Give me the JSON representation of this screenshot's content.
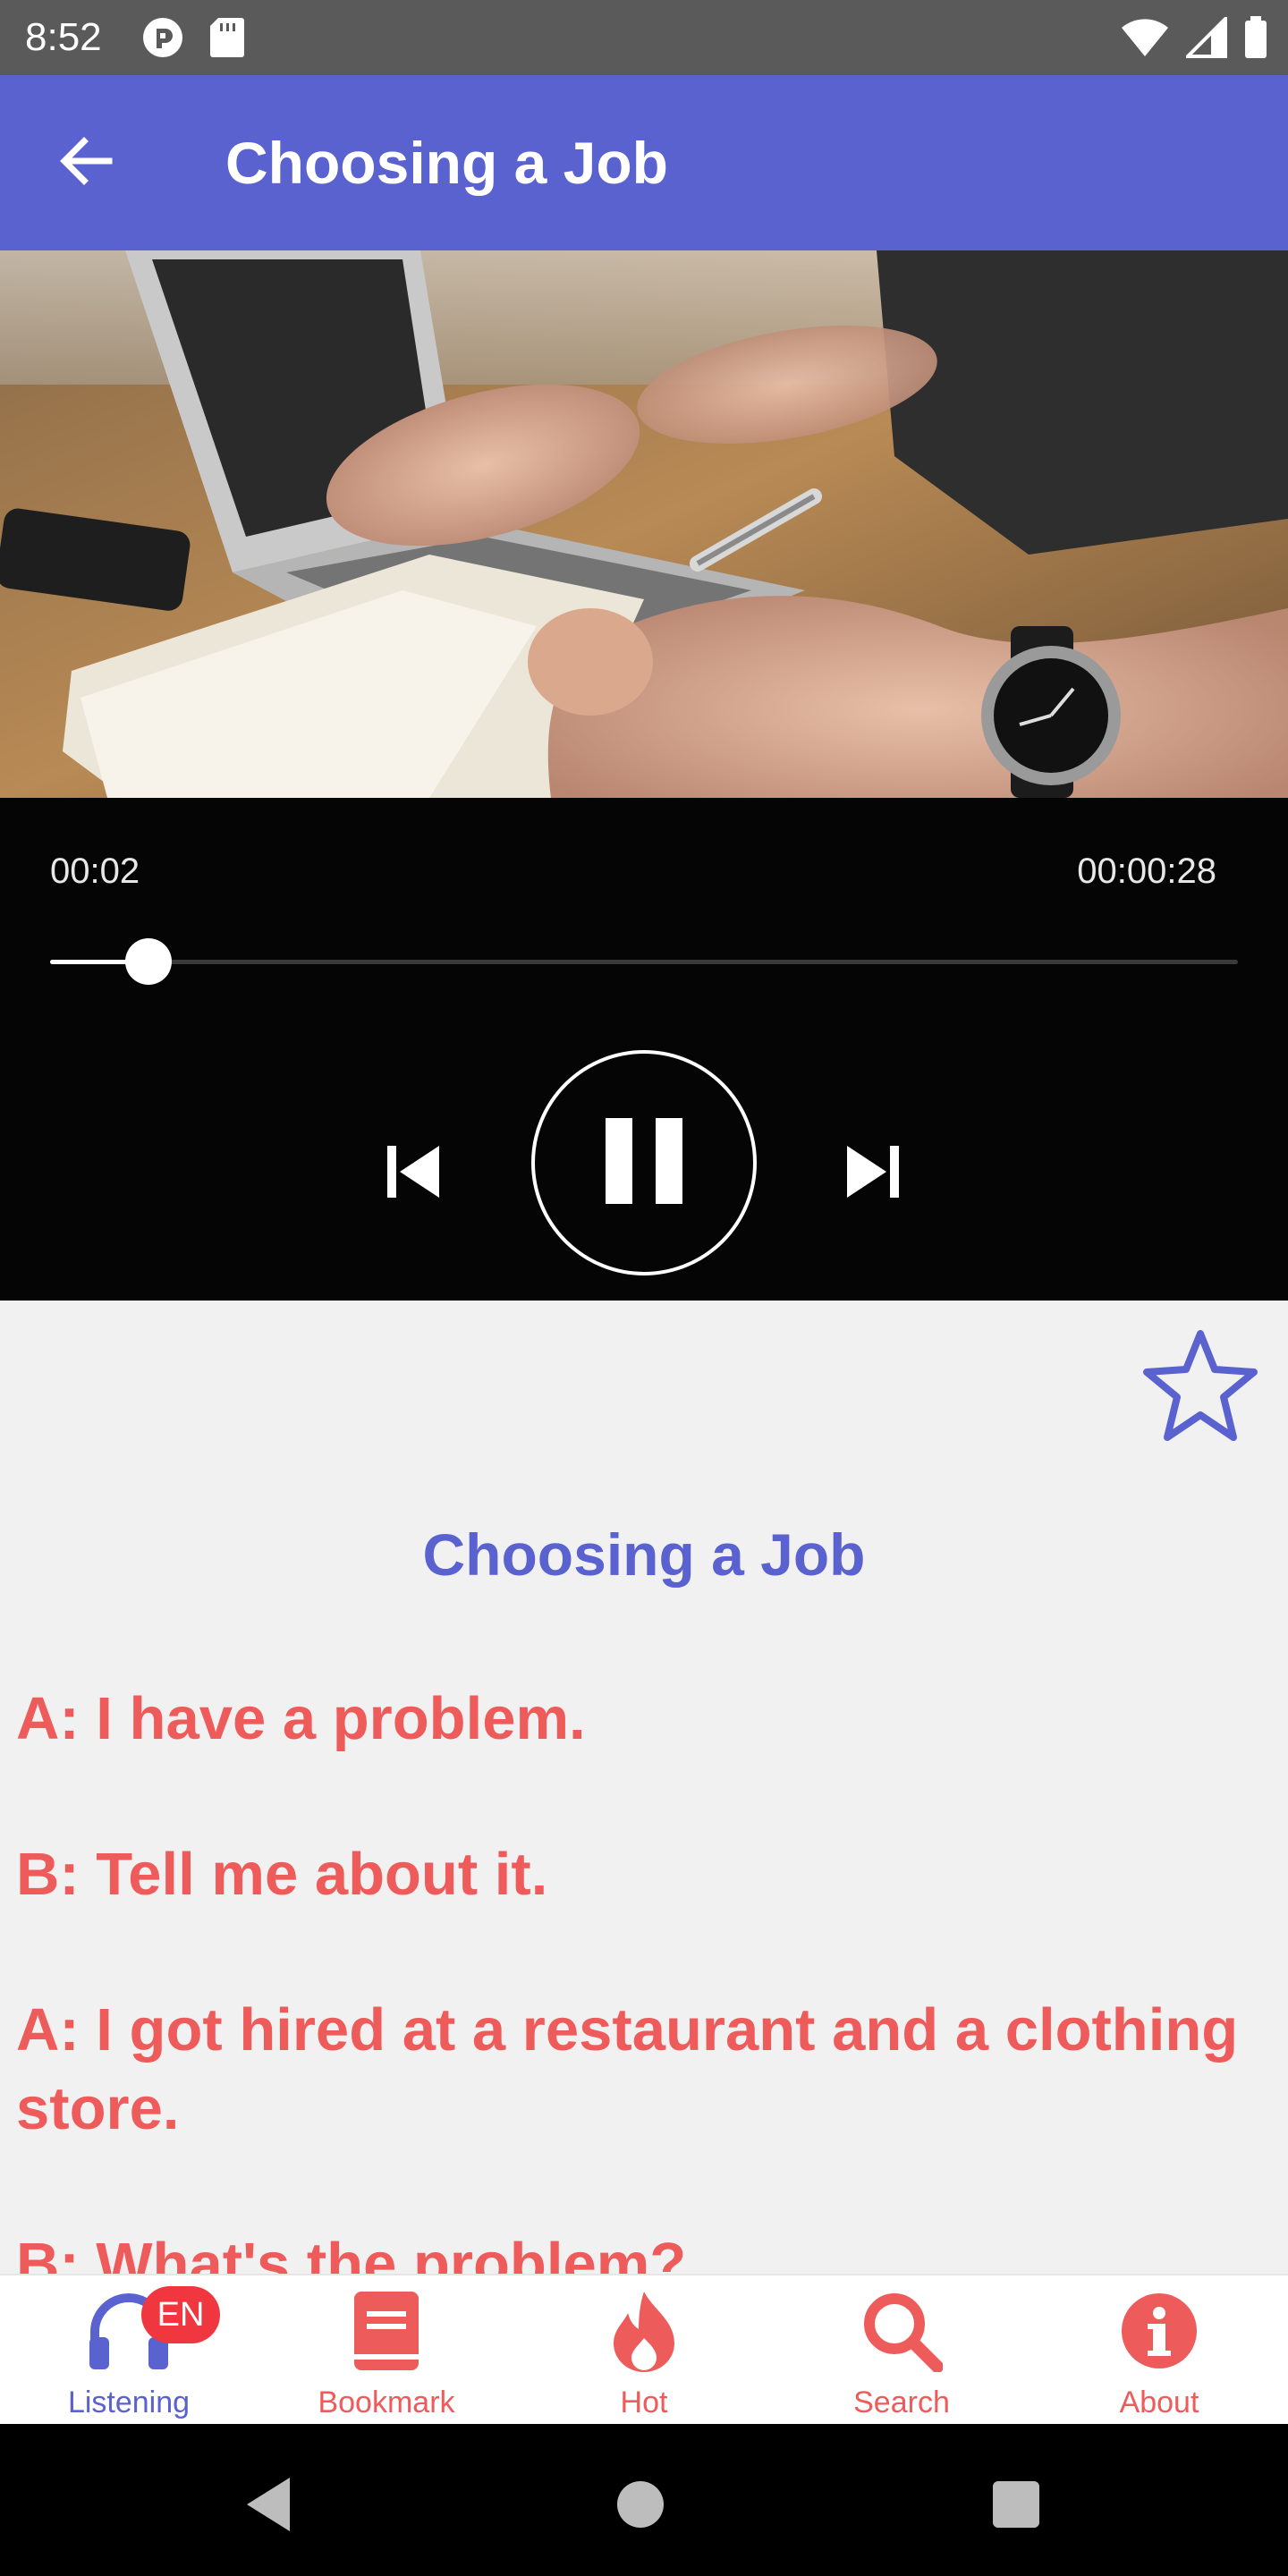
{
  "status_bar": {
    "time": "8:52",
    "icons": [
      "privacy-icon",
      "sd-card-icon",
      "wifi-icon",
      "signal-icon",
      "battery-icon"
    ]
  },
  "app_bar": {
    "title": "Choosing a Job",
    "back_icon": "arrow-back-icon",
    "background_color": "#5a62d0"
  },
  "hero_image": {
    "subject": "hand writing in a notebook beside a laptop"
  },
  "player": {
    "current_time": "00:02",
    "total_time": "00:00:28",
    "progress": 0.083,
    "state": "playing",
    "controls": [
      "skip-previous-icon",
      "pause-icon",
      "skip-next-icon"
    ]
  },
  "lesson": {
    "bookmark_icon": "star-outline-icon",
    "title": "Choosing a Job",
    "dialogue": [
      "A: I have a problem.",
      "B: Tell me about it.",
      "A: I got hired at a restaurant and a clothing store.",
      "B: What's the problem?"
    ],
    "title_color": "#5a62d0",
    "dialogue_color": "#ee5b5b"
  },
  "bottom_nav": {
    "items": [
      {
        "label": "Listening",
        "icon": "headphones-icon",
        "active": true,
        "badge": "EN"
      },
      {
        "label": "Bookmark",
        "icon": "book-icon",
        "active": false
      },
      {
        "label": "Hot",
        "icon": "fire-icon",
        "active": false
      },
      {
        "label": "Search",
        "icon": "search-icon",
        "active": false
      },
      {
        "label": "About",
        "icon": "info-icon",
        "active": false
      }
    ],
    "active_color": "#5a62d0",
    "inactive_color": "#ee5b5b"
  },
  "system_nav": {
    "buttons": [
      "back-triangle-icon",
      "home-circle-icon",
      "recents-square-icon"
    ]
  }
}
